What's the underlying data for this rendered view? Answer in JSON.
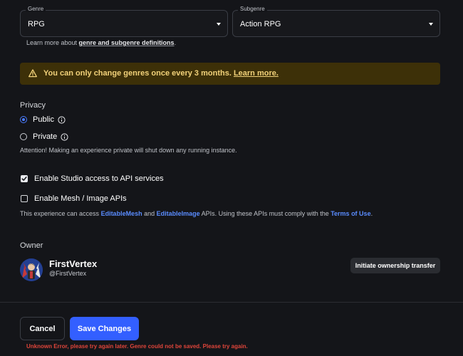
{
  "genre": {
    "label": "Genre",
    "value": "RPG"
  },
  "subgenre": {
    "label": "Subgenre",
    "value": "Action RPG"
  },
  "learn_more": {
    "prefix": "Learn more about ",
    "link": "genre and subgenre definitions",
    "suffix": "."
  },
  "warning": {
    "text": "You can only change genres once every 3 months. ",
    "link": "Learn more.",
    "color": "#3d3008"
  },
  "privacy": {
    "label": "Privacy",
    "options": [
      {
        "label": "Public",
        "selected": true
      },
      {
        "label": "Private",
        "selected": false
      }
    ],
    "note": "Attention! Making an experience private will shut down any running instance."
  },
  "api": {
    "studio_access": {
      "label": "Enable Studio access to API services",
      "checked": true
    },
    "mesh_image": {
      "label": "Enable Mesh / Image APIs",
      "checked": false
    },
    "note_prefix": "This experience can access ",
    "link_mesh": "EditableMesh",
    "note_and": " and ",
    "link_image": "EditableImage",
    "note_middle": " APIs. Using these APIs must comply with the ",
    "link_terms": "Terms of Use",
    "note_suffix": "."
  },
  "owner": {
    "label": "Owner",
    "name": "FirstVertex",
    "handle": "@FirstVertex",
    "transfer_label": "Initiate ownership transfer"
  },
  "actions": {
    "cancel_label": "Cancel",
    "save_label": "Save Changes",
    "error": "Unknown Error, please try again later. Genre could not be saved. Please try again.",
    "primary_color": "#335fff"
  }
}
